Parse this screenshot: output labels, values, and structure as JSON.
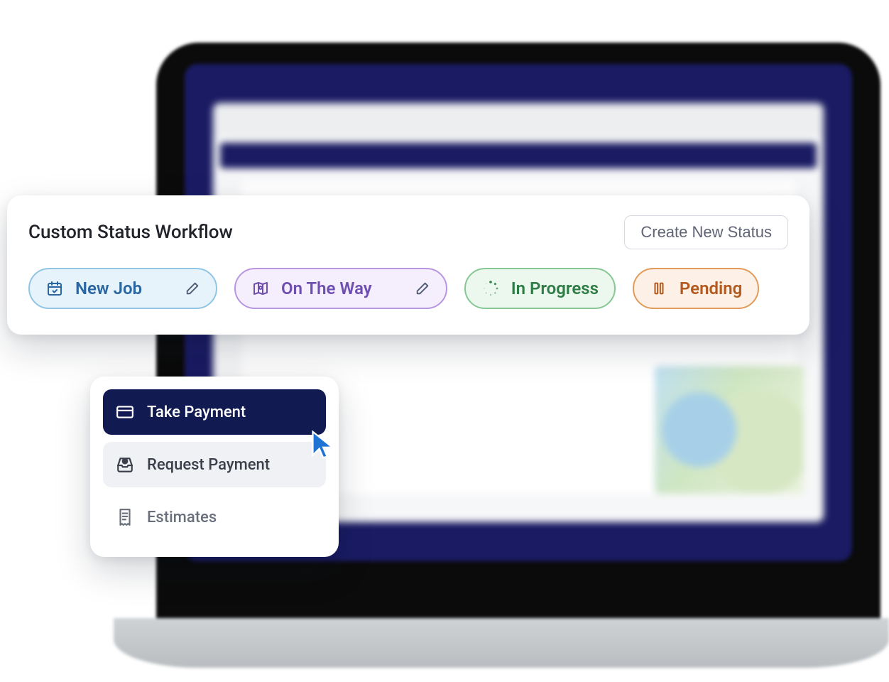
{
  "workflow": {
    "title": "Custom Status Workflow",
    "create_button": "Create New Status",
    "statuses": [
      {
        "label": "New Job",
        "icon": "calendar-check-icon",
        "editable": true
      },
      {
        "label": "On The Way",
        "icon": "map-pin-icon",
        "editable": true
      },
      {
        "label": "In Progress",
        "icon": "spinner-icon",
        "editable": false
      },
      {
        "label": "Pending",
        "icon": "pause-icon",
        "editable": false
      }
    ]
  },
  "action_menu": {
    "items": [
      {
        "label": "Take Payment",
        "icon": "credit-card-icon",
        "state": "active"
      },
      {
        "label": "Request Payment",
        "icon": "inbox-dollar-icon",
        "state": "hover"
      },
      {
        "label": "Estimates",
        "icon": "receipt-icon",
        "state": "normal"
      }
    ]
  }
}
